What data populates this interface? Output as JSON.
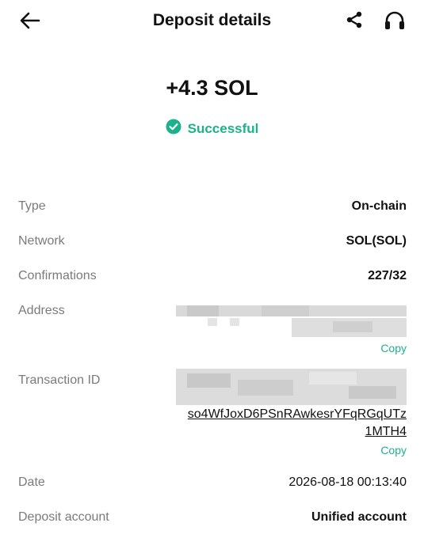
{
  "header": {
    "title": "Deposit details",
    "back_icon": "arrow-left-icon",
    "share_icon": "share-icon",
    "support_icon": "headset-icon"
  },
  "summary": {
    "amount": "+4.3 SOL",
    "status": "Successful",
    "status_color": "#1bb28b"
  },
  "details": {
    "type_label": "Type",
    "type_value": "On-chain",
    "network_label": "Network",
    "network_value": "SOL(SOL)",
    "confirmations_label": "Confirmations",
    "confirmations_value": "227/32",
    "address_label": "Address",
    "address_copy": "Copy",
    "txid_label": "Transaction ID",
    "txid_visible_line1": "so4WfJoxD6PSnRAwkesrYFqRGqUTz",
    "txid_visible_line2": "1MTH4",
    "txid_copy": "Copy",
    "date_label": "Date",
    "date_value": "2026-08-18 00:13:40",
    "account_label": "Deposit account",
    "account_value": "Unified account"
  },
  "colors": {
    "accent": "#1bb28b",
    "label": "#7b7b7b",
    "text": "#111111"
  }
}
